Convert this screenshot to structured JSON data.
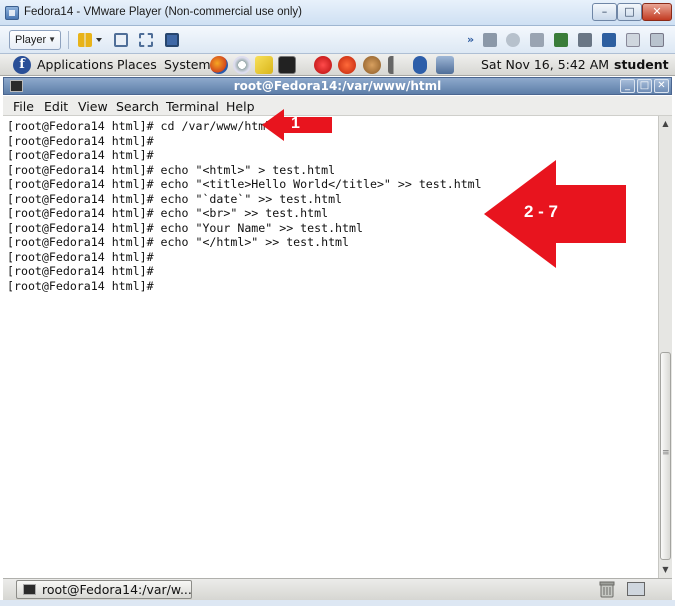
{
  "vmware": {
    "title": "Fedora14 - VMware Player (Non-commercial use only)",
    "player_menu": "Player",
    "window_controls": [
      "minimize",
      "maximize",
      "close"
    ]
  },
  "gnome_panel": {
    "menus": [
      "Applications",
      "Places",
      "System"
    ],
    "launchers": [
      "firefox-icon",
      "evolution-icon",
      "notes-icon",
      "terminal-icon"
    ],
    "tray": [
      "update-alert-icon",
      "selinux-alert-icon",
      "cookie-icon",
      "volume-icon",
      "bluetooth-icon",
      "network-icon"
    ],
    "clock": "Sat Nov 16,  5:42 AM",
    "user": "student"
  },
  "terminal": {
    "title": "root@Fedora14:/var/www/html",
    "menus": [
      "File",
      "Edit",
      "View",
      "Search",
      "Terminal",
      "Help"
    ],
    "lines": [
      "[root@Fedora14 html]# cd /var/www/html",
      "[root@Fedora14 html]#",
      "[root@Fedora14 html]#",
      "[root@Fedora14 html]# echo \"<html>\" > test.html",
      "[root@Fedora14 html]# echo \"<title>Hello World</title>\" >> test.html",
      "[root@Fedora14 html]# echo \"`date`\" >> test.html",
      "[root@Fedora14 html]# echo \"<br>\" >> test.html",
      "[root@Fedora14 html]# echo \"Your Name\" >> test.html",
      "[root@Fedora14 html]# echo \"</html>\" >> test.html",
      "[root@Fedora14 html]#",
      "[root@Fedora14 html]#",
      "[root@Fedora14 html]#"
    ]
  },
  "taskbar": {
    "task_label": "root@Fedora14:/var/w..."
  },
  "annotations": {
    "arrow1_label": "1",
    "arrow2_label": "2 - 7",
    "color": "#e8141e"
  }
}
